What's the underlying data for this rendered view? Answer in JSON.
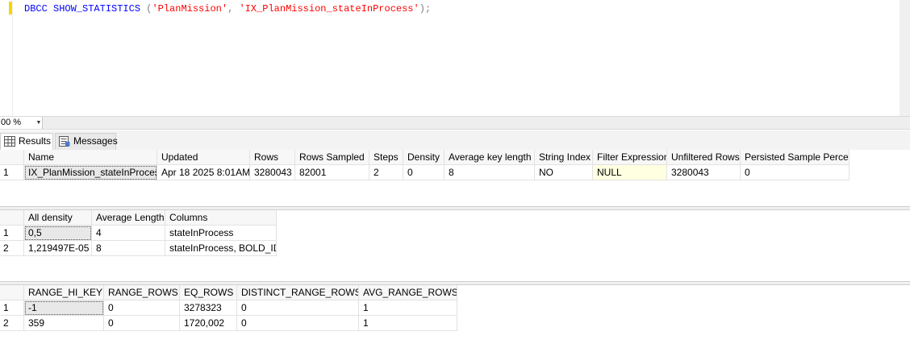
{
  "editor": {
    "tokens": [
      {
        "text": "DBCC SHOW_STATISTICS ",
        "cls": "kw"
      },
      {
        "text": "(",
        "cls": "punct"
      },
      {
        "text": "'PlanMission'",
        "cls": "str"
      },
      {
        "text": ", ",
        "cls": "punct"
      },
      {
        "text": "'IX_PlanMission_stateInProcess'",
        "cls": "str"
      },
      {
        "text": ");",
        "cls": "punct"
      }
    ]
  },
  "zoom": {
    "value": "00 %"
  },
  "tabs": [
    {
      "label": "Results",
      "icon": "grid-icon",
      "active": true
    },
    {
      "label": "Messages",
      "icon": "messages-icon",
      "active": false
    }
  ],
  "grid1": {
    "headers": [
      "Name",
      "Updated",
      "Rows",
      "Rows Sampled",
      "Steps",
      "Density",
      "Average key length",
      "String Index",
      "Filter Expression",
      "Unfiltered Rows",
      "Persisted Sample Percent"
    ],
    "rows": [
      {
        "num": "1",
        "cells": [
          "IX_PlanMission_stateInProcess",
          "Apr 18 2025  8:01AM",
          "3280043",
          "82001",
          "2",
          "0",
          "8",
          "NO",
          "NULL",
          "3280043",
          "0"
        ]
      }
    ]
  },
  "grid2": {
    "headers": [
      "All density",
      "Average Length",
      "Columns"
    ],
    "rows": [
      {
        "num": "1",
        "cells": [
          "0,5",
          "4",
          "stateInProcess"
        ]
      },
      {
        "num": "2",
        "cells": [
          "1,219497E-05",
          "8",
          "stateInProcess, BOLD_ID"
        ]
      }
    ]
  },
  "grid3": {
    "headers": [
      "RANGE_HI_KEY",
      "RANGE_ROWS",
      "EQ_ROWS",
      "DISTINCT_RANGE_ROWS",
      "AVG_RANGE_ROWS"
    ],
    "rows": [
      {
        "num": "1",
        "cells": [
          "-1",
          "0",
          "3278323",
          "0",
          "1"
        ]
      },
      {
        "num": "2",
        "cells": [
          "359",
          "0",
          "1720,002",
          "0",
          "1"
        ]
      }
    ]
  }
}
